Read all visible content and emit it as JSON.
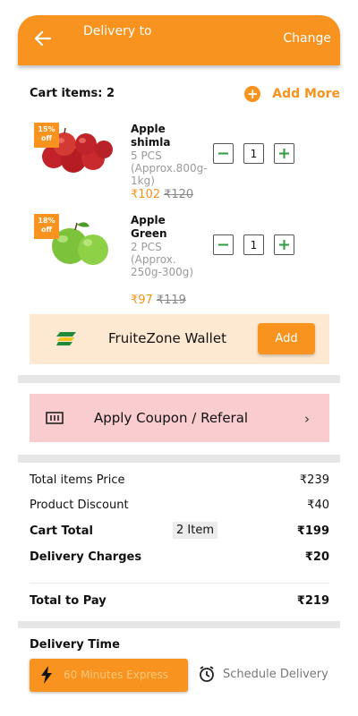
{
  "header": {
    "title": "Delivery to",
    "change_label": "Change"
  },
  "cart": {
    "count_label": "Cart items: 2",
    "add_more_label": "Add More"
  },
  "items": [
    {
      "badge_pct": "15%",
      "badge_off": "off",
      "name": "Apple shimla",
      "desc": "5 PCS (Approx.800g-1kg)",
      "price": "₹102",
      "mrp": "₹120",
      "qty": "1"
    },
    {
      "badge_pct": "18%",
      "badge_off": "off",
      "name": "Apple Green",
      "desc": "2 PCS (Approx. 250g-300g)",
      "price": "₹97",
      "mrp": "₹119",
      "qty": "1"
    }
  ],
  "wallet": {
    "label": "FruiteZone Wallet",
    "add_label": "Add"
  },
  "coupon": {
    "label": "Apply Coupon / Referal"
  },
  "summary": {
    "total_items_label": "Total items Price",
    "total_items_value": "₹239",
    "discount_label": "Product Discount",
    "discount_value": "₹40",
    "cart_total_label": "Cart Total",
    "cart_total_items": "2 Item",
    "cart_total_value": "₹199",
    "delivery_label": "Delivery Charges",
    "delivery_value": "₹20",
    "to_pay_label": "Total to Pay",
    "to_pay_value": "₹219"
  },
  "delivery_time": {
    "title": "Delivery Time",
    "express_label": "60 Minutes Express",
    "schedule_label": "Schedule Delivery"
  },
  "colors": {
    "accent": "#f7931e",
    "wallet_bg": "#fde9d2",
    "coupon_bg": "#f9ccd0",
    "plus_green": "#2e9e3e"
  }
}
